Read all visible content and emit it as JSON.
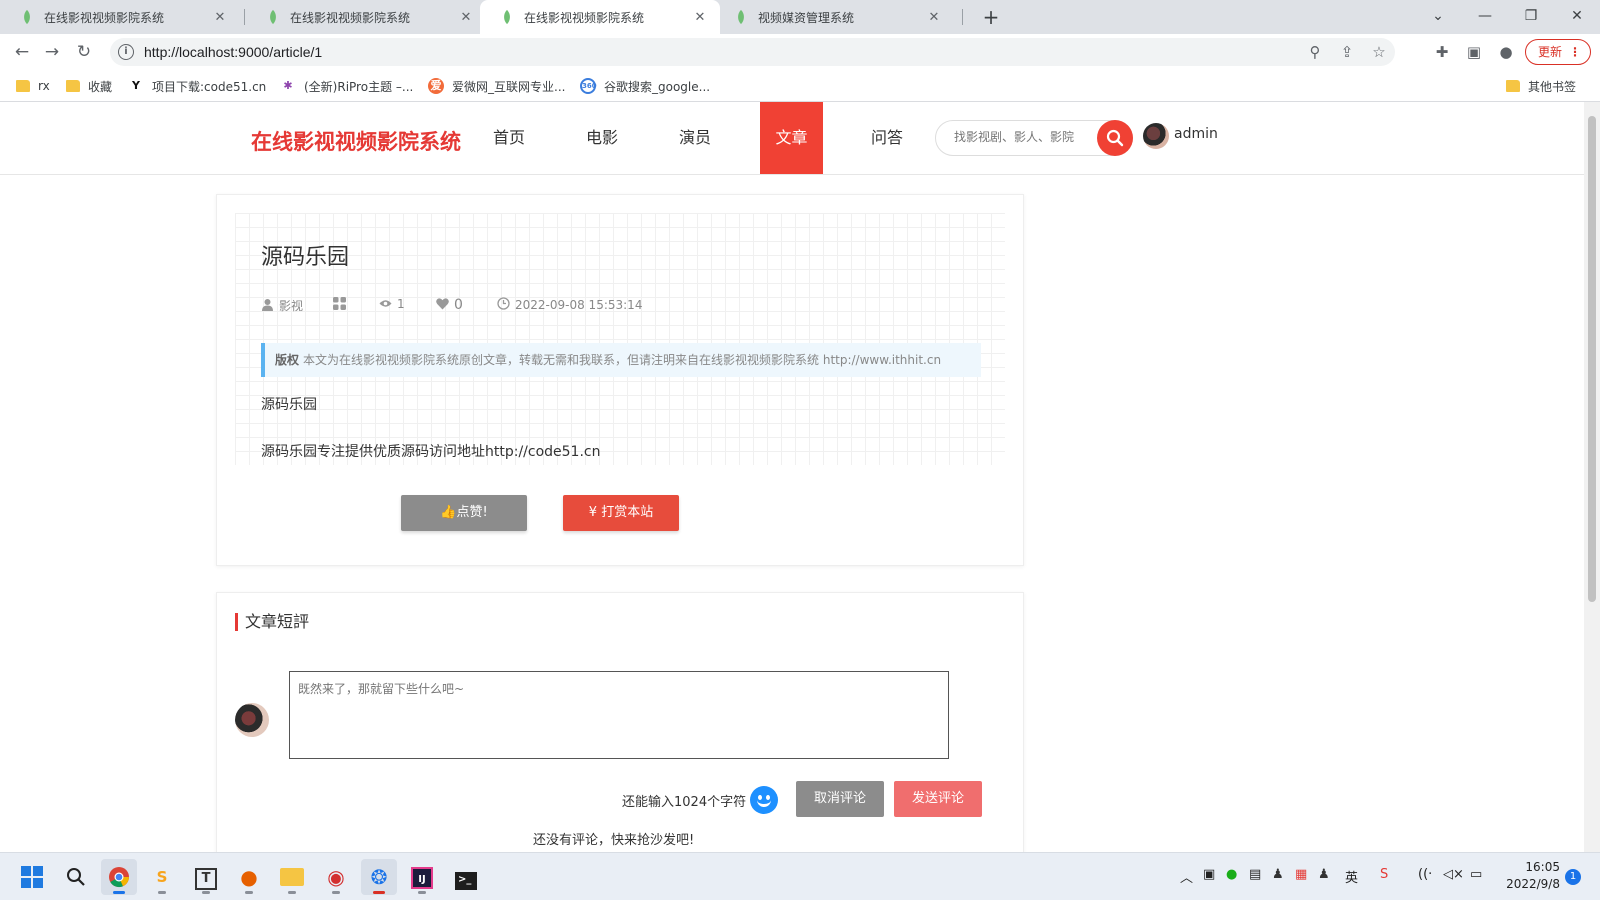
{
  "browser": {
    "tabs": [
      {
        "title": "在线影视视频影院系统"
      },
      {
        "title": "在线影视视频影院系统"
      },
      {
        "title": "在线影视视频影院系统"
      },
      {
        "title": "视频媒资管理系统"
      }
    ],
    "active_tab": 2,
    "url": "http://localhost:9000/article/1",
    "update_label": "更新",
    "bookmarks": [
      "rx",
      "收藏",
      "项目下载:code51.cn",
      "(全新)RiPro主题 –...",
      "爱微网_互联网专业...",
      "谷歌搜索_google..."
    ],
    "other_bookmarks": "其他书签"
  },
  "site": {
    "logo": "在线影视视频影院系统",
    "nav": [
      "首页",
      "电影",
      "演员",
      "文章",
      "问答"
    ],
    "active_nav": "文章",
    "search_placeholder": "找影视剧、影人、影院",
    "username": "admin"
  },
  "article": {
    "title": "源码乐园",
    "author": "影视",
    "views": "1",
    "likes": "0",
    "date": "2022-09-08 15:53:14",
    "copyright_label": "版权",
    "copyright_text": "本文为在线影视视频影院系统原创文章，转载无需和我联系，但请注明来自在线影视视频影院系统 http://www.ithhit.cn",
    "paragraphs": [
      "源码乐园",
      "源码乐园专注提供优质源码访问地址http://code51.cn"
    ],
    "like_button": "👍点赞!",
    "tip_button": "¥  打赏本站"
  },
  "comments": {
    "title": "文章短評",
    "placeholder": "既然来了，那就留下些什么吧~",
    "remaining": "还能输入1024个字符",
    "cancel_button": "取消评论",
    "send_button": "发送评论",
    "empty_text": "还没有评论，快来抢沙发吧!"
  },
  "taskbar": {
    "ime": "英",
    "time": "16:05",
    "date": "2022/9/8",
    "notifications": "1"
  },
  "colors": {
    "accent": "#f04134",
    "logo": "#e53935",
    "copyright_border": "#5bb3f0"
  }
}
